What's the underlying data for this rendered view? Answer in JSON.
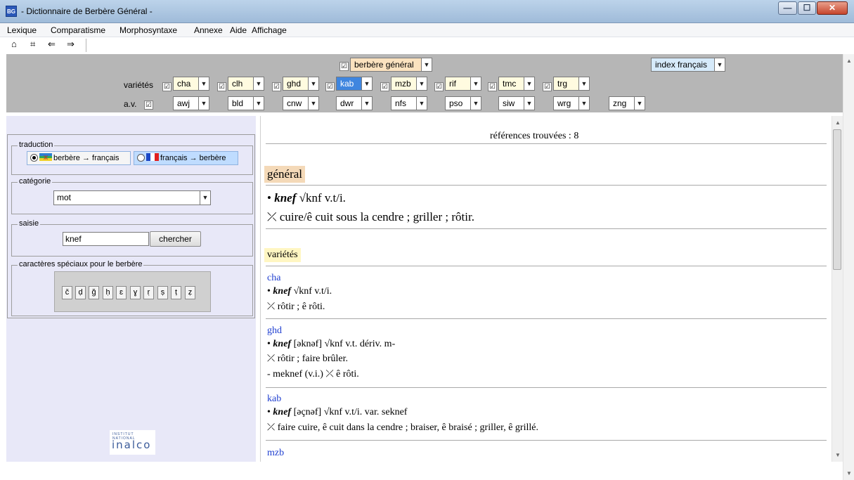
{
  "window": {
    "icon_text": "BG",
    "title": "- Dictionnaire de Berbère Général -",
    "minimize": "—",
    "maximize": "☐",
    "close": "✕"
  },
  "menu": [
    "Lexique",
    "Comparatisme",
    "Morphosyntaxe",
    "Annexe",
    "Aide",
    "Affichage"
  ],
  "nav": [
    "⌂",
    "⌗",
    "⇐",
    "⇒"
  ],
  "filters": {
    "general_checkbox": "☑",
    "general_select": "berbère général",
    "index_select": "index français",
    "varietes_label": "variétés",
    "av_label": "a.v.",
    "varietes": [
      "cha",
      "clh",
      "ghd",
      "kab",
      "mzb",
      "rif",
      "tmc",
      "trg"
    ],
    "av": [
      "awj",
      "bld",
      "cnw",
      "dwr",
      "nfs",
      "pso",
      "siw",
      "wrg",
      "zng"
    ]
  },
  "left": {
    "traduction_legend": "traduction",
    "radio1": "berbère → français",
    "radio2": "français → berbère",
    "categorie_legend": "catégorie",
    "categorie_value": "mot",
    "saisie_legend": "saisie",
    "saisie_value": "knef",
    "chercher": "chercher",
    "chars_legend": "caractères spéciaux pour le berbère",
    "chars": [
      "č",
      "ḍ",
      "ğ",
      "ḥ",
      "ɛ",
      "ɣ",
      "ṛ",
      "ṣ",
      "ṭ",
      "ẓ"
    ],
    "logo": "inalco",
    "logo_sub": "INSTITUT NATIONAL"
  },
  "main": {
    "refs": "références trouvées : 8",
    "general_heading": "général",
    "general_entry_bullet": "•",
    "general_entry_word": "knef",
    "general_entry_root": "√knf  v.t/i.",
    "general_entry_def": "⤫ cuire/ê cuit sous la cendre ; griller ; rôtir.",
    "varietes_heading": "variétés",
    "entries": [
      {
        "dialect": "cha",
        "word": "knef",
        "rest": "√knf  v.t/i.",
        "lines": [
          "⤫ rôtir ; ê rôti."
        ]
      },
      {
        "dialect": "ghd",
        "word": "knef",
        "rest": "[əknəf]  √knf  v.t.  dériv. m-",
        "lines": [
          "⤫ rôtir ; faire brûler.",
          "- meknef (v.i.) ⤫ ê rôti."
        ]
      },
      {
        "dialect": "kab",
        "word": "knef",
        "rest": "[əçnəf]  √knf  v.t/i.  var. seknef",
        "lines": [
          "⤫ faire cuire, ê cuit dans la cendre ; braiser, ê braisé ; griller, ê grillé."
        ]
      },
      {
        "dialect": "mzb",
        "word": "",
        "rest": "",
        "lines": []
      }
    ]
  }
}
